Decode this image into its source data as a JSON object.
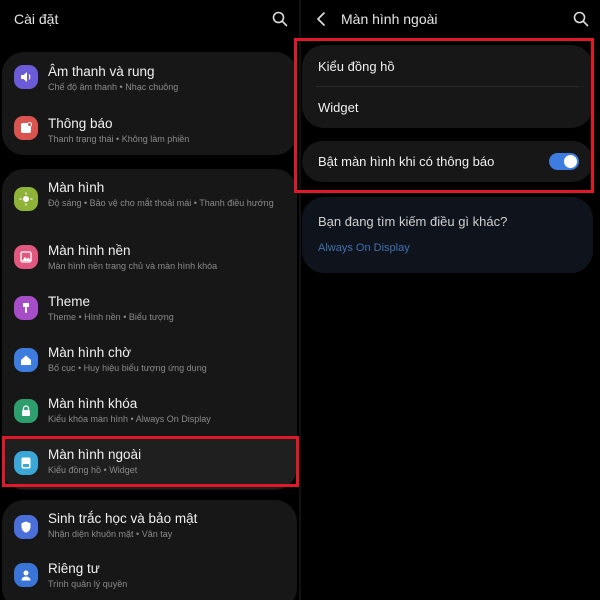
{
  "left": {
    "title": "Cài đặt",
    "groups": [
      {
        "items": [
          {
            "label": "Âm thanh và rung",
            "sub": "Chế độ âm thanh  •  Nhạc chuông",
            "icon": "sound-icon",
            "color": "#6b5bd6"
          },
          {
            "label": "Thông báo",
            "sub": "Thanh trạng thái  •  Không làm phiền",
            "icon": "notification-icon",
            "color": "#d9534f"
          }
        ]
      },
      {
        "items": [
          {
            "label": "Màn hình",
            "sub": "Độ sáng  •  Bảo vệ cho mắt thoải mái  •  Thanh điều hướng",
            "icon": "brightness-icon",
            "color": "#8fb339"
          },
          {
            "label": "Màn hình nền",
            "sub": "Màn hình nền trang chủ và màn hình khóa",
            "icon": "wallpaper-icon",
            "color": "#e05780"
          },
          {
            "label": "Theme",
            "sub": "Theme  •  Hình nền  •  Biểu tượng",
            "icon": "theme-icon",
            "color": "#a64dc7"
          },
          {
            "label": "Màn hình chờ",
            "sub": "Bố cục  •  Huy hiệu biểu tượng ứng dụng",
            "icon": "home-icon",
            "color": "#3d7de0"
          },
          {
            "label": "Màn hình khóa",
            "sub": "Kiểu khóa màn hình  •  Always On Display",
            "icon": "lock-icon",
            "color": "#2e9e6e"
          },
          {
            "label": "Màn hình ngoài",
            "sub": "Kiểu đồng hồ  •  Widget",
            "icon": "cover-screen-icon",
            "color": "#3aa7d6"
          }
        ]
      },
      {
        "items": [
          {
            "label": "Sinh trắc học và bảo mật",
            "sub": "Nhận diện khuôn mặt  •  Vân tay",
            "icon": "shield-icon",
            "color": "#4a6fd9"
          },
          {
            "label": "Riêng tư",
            "sub": "Trình quản lý quyền",
            "icon": "privacy-icon",
            "color": "#3a74d6"
          }
        ]
      }
    ]
  },
  "right": {
    "title": "Màn hình ngoài",
    "clock_style": "Kiểu đồng hồ",
    "widget": "Widget",
    "notif_toggle_label": "Bật màn hình khi có thông báo",
    "notif_toggle_on": true,
    "suggest_title": "Bạn đang tìm kiếm điều gì khác?",
    "suggest_link": "Always On Display",
    "link_color": "#3f6fb0"
  }
}
